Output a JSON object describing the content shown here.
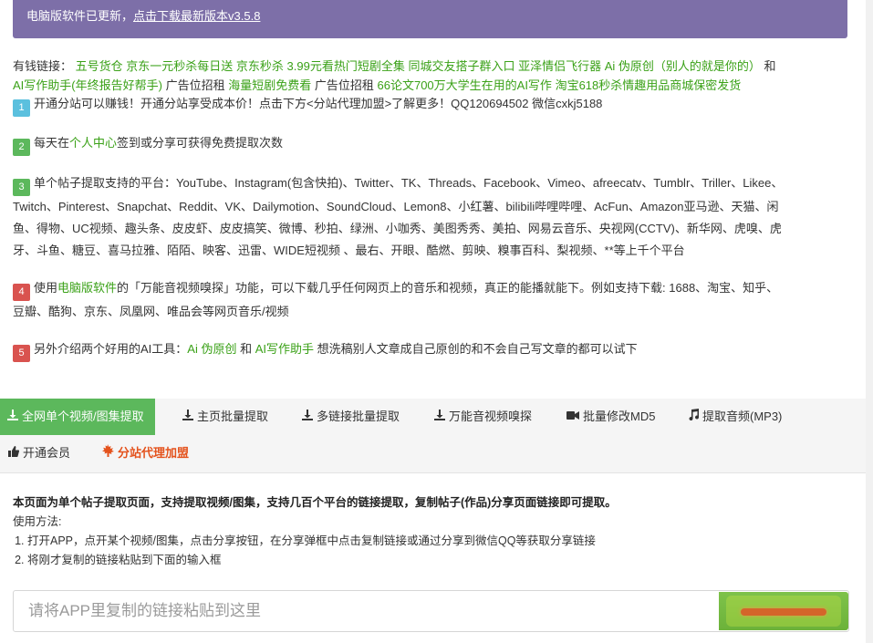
{
  "banner": {
    "text": "电脑版软件已更新，",
    "link": "点击下载最新版本v3.5.8"
  },
  "links": {
    "label": "有钱链接：",
    "items": [
      "五号货仓",
      "京东一元秒杀每日送",
      "京东秒杀 3.99元看热门短剧全集",
      "同城交友搭子群入口",
      "亚泽情侣飞行器",
      "Ai 伪原创（别人的就是你的）"
    ],
    "and": "和",
    "item_write": "AI写作助手(年终报告好帮手)",
    "ad1": "广告位招租",
    "item_drama": "海量短剧免费看",
    "ad2": "广告位招租",
    "item_paper": "66论文700万大学生在用的AI写作",
    "item_taobao": "淘宝618秒杀情趣用品商城保密发货"
  },
  "items": {
    "n1": "1",
    "t1": "开通分站可以赚钱！开通分站享受成本价！点击下方<分站代理加盟>了解更多！QQ120694502 微信cxkj5188",
    "n2": "2",
    "t2a": "每天在",
    "t2link": "个人中心",
    "t2b": "签到或分享可获得免费提取次数",
    "n3": "3",
    "t3l1": "单个帖子提取支持的平台：YouTube、Instagram(包含快拍)、Twitter、TK、Threads、Facebook、Vimeo、afreecatv、Tumblr、Triller、Likee、",
    "t3l2": "Twitch、Pinterest、Snapchat、Reddit、VK、Dailymotion、SoundCloud、Lemon8、小红薯、bilibili哔哩哔哩、AcFun、Amazon亚马逊、天猫、闲",
    "t3l3": "鱼、得物、UC视频、趣头条、皮皮虾、皮皮搞笑、微博、秒拍、绿洲、小咖秀、美图秀秀、美拍、网易云音乐、央视网(CCTV)、新华网、虎嗅、虎",
    "t3l4": "牙、斗鱼、糖豆、喜马拉雅、陌陌、映客、迅雷、WIDE短视频 、最右、开眼、酷燃、剪映、糗事百科、梨视频、**等上千个平台",
    "n4": "4",
    "t4a": "使用",
    "t4link": "电脑版软件",
    "t4b": "的「万能音视频嗅探」功能，可以下载几乎任何网页上的音乐和视频，真正的能播就能下。例如支持下载: 1688、淘宝、知乎、",
    "t4l2": "豆瓣、酷狗、京东、凤凰网、唯品会等网页音乐/视频",
    "n5": "5",
    "t5a": "另外介绍两个好用的AI工具：",
    "t5link1": "Ai 伪原创",
    "t5and": "和",
    "t5link2": "AI写作助手",
    "t5b": "想洗稿别人文章成自己原创的和不会自己写文章的都可以试下"
  },
  "tabs": {
    "t1": "全网单个视频/图集提取",
    "t2": "主页批量提取",
    "t3": "多链接批量提取",
    "t4": "万能音视频嗅探",
    "t5": "批量修改MD5",
    "t6": "提取音频(MP3)",
    "t7": "开通会员",
    "t8": "分站代理加盟"
  },
  "desc": {
    "bold": "本页面为单个帖子提取页面，支持提取视频/图集，支持几百个平台的链接提取，复制帖子(作品)分享页面链接即可提取。",
    "usage": "使用方法:",
    "step1": "打开APP，点开某个视频/图集，点击分享按钮，在分享弹框中点击复制链接或通过分享到微信QQ等获取分享链接",
    "step2": "将刚才复制的链接粘贴到下面的输入框"
  },
  "input": {
    "placeholder": "请将APP里复制的链接粘贴到这里"
  },
  "colors": {
    "banner": "#7d6fa8",
    "green": "#5cb85c",
    "link_green": "#3aa117",
    "red": "#e4521c"
  }
}
